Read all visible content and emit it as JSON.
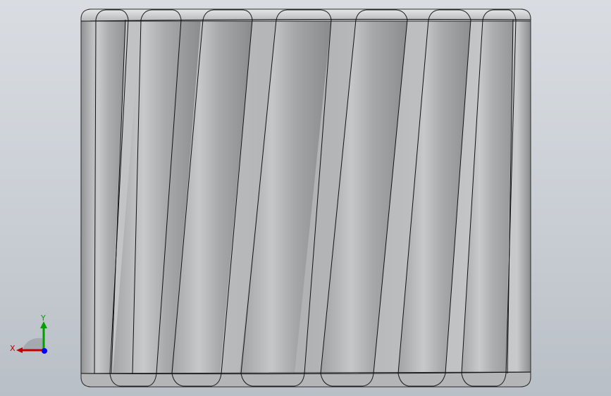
{
  "viewport": {
    "description_label": "",
    "model": {
      "name": "helical-gear-like-part",
      "flute_count": 8,
      "base_color": "#a9abad",
      "edge_color": "#000000"
    },
    "triad": {
      "x_label": "X",
      "y_label": "Y",
      "colors": {
        "x": "#c00000",
        "y": "#00a000",
        "z": "#0000ff"
      }
    }
  }
}
